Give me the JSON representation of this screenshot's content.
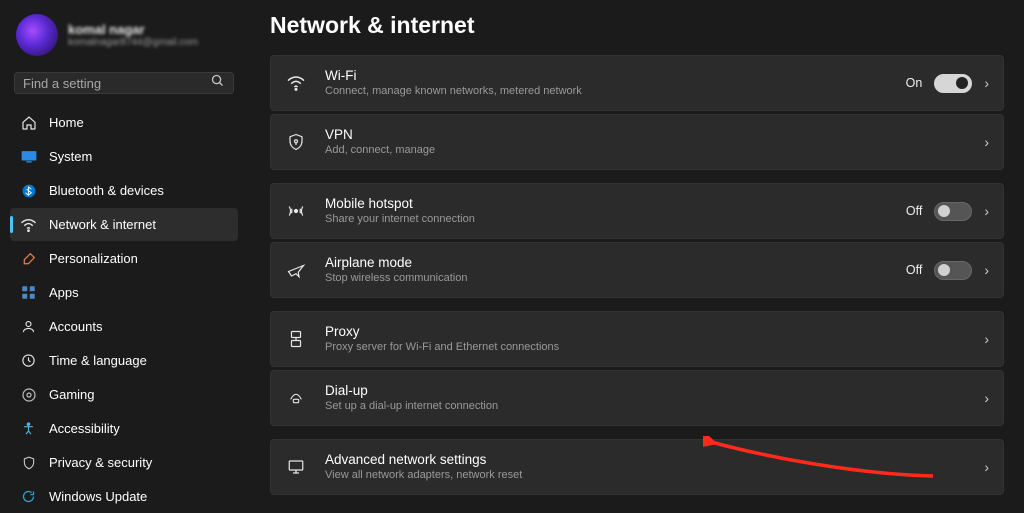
{
  "profile": {
    "name": "komal nagar",
    "email": "komalnagar8744@gmail.com"
  },
  "search": {
    "placeholder": "Find a setting"
  },
  "nav": [
    {
      "label": "Home",
      "icon": "home"
    },
    {
      "label": "System",
      "icon": "system"
    },
    {
      "label": "Bluetooth & devices",
      "icon": "bluetooth"
    },
    {
      "label": "Network & internet",
      "icon": "wifi",
      "selected": true
    },
    {
      "label": "Personalization",
      "icon": "brush"
    },
    {
      "label": "Apps",
      "icon": "apps"
    },
    {
      "label": "Accounts",
      "icon": "account"
    },
    {
      "label": "Time & language",
      "icon": "clock"
    },
    {
      "label": "Gaming",
      "icon": "gaming"
    },
    {
      "label": "Accessibility",
      "icon": "accessibility"
    },
    {
      "label": "Privacy & security",
      "icon": "privacy"
    },
    {
      "label": "Windows Update",
      "icon": "update"
    }
  ],
  "page": {
    "title": "Network & internet"
  },
  "cards": {
    "wifi": {
      "title": "Wi-Fi",
      "sub": "Connect, manage known networks, metered network",
      "state": "On"
    },
    "vpn": {
      "title": "VPN",
      "sub": "Add, connect, manage"
    },
    "hotspot": {
      "title": "Mobile hotspot",
      "sub": "Share your internet connection",
      "state": "Off"
    },
    "airplane": {
      "title": "Airplane mode",
      "sub": "Stop wireless communication",
      "state": "Off"
    },
    "proxy": {
      "title": "Proxy",
      "sub": "Proxy server for Wi-Fi and Ethernet connections"
    },
    "dialup": {
      "title": "Dial-up",
      "sub": "Set up a dial-up internet connection"
    },
    "advanced": {
      "title": "Advanced network settings",
      "sub": "View all network adapters, network reset"
    }
  }
}
